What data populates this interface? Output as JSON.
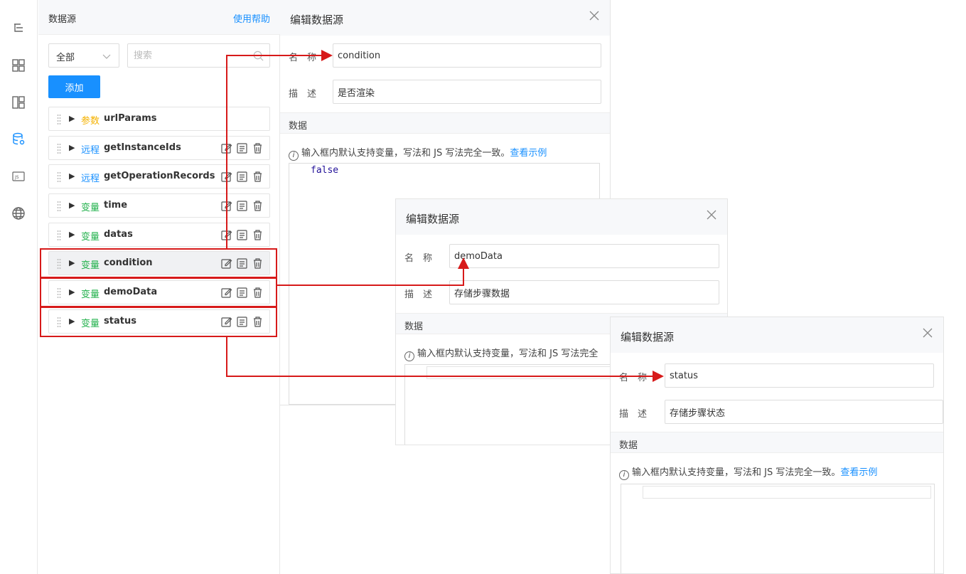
{
  "panel": {
    "title": "数据源",
    "help": "使用帮助",
    "filter_value": "全部",
    "search_placeholder": "搜索",
    "add_label": "添加"
  },
  "items": [
    {
      "tag": "参数",
      "tag_type": "param",
      "name": "urlParams"
    },
    {
      "tag": "远程",
      "tag_type": "remote",
      "name": "getInstanceIds"
    },
    {
      "tag": "远程",
      "tag_type": "remote",
      "name": "getOperationRecords"
    },
    {
      "tag": "变量",
      "tag_type": "var",
      "name": "time"
    },
    {
      "tag": "变量",
      "tag_type": "var",
      "name": "datas"
    },
    {
      "tag": "变量",
      "tag_type": "var",
      "name": "condition"
    },
    {
      "tag": "变量",
      "tag_type": "var",
      "name": "demoData"
    },
    {
      "tag": "变量",
      "tag_type": "var",
      "name": "status"
    }
  ],
  "dialog_common": {
    "title": "编辑数据源",
    "name_label": "名　称",
    "desc_label": "描　述",
    "data_section": "数据",
    "tip_text": "输入框内默认支持变量，写法和 JS 写法完全一致。",
    "tip_link": "查看示例",
    "tip_text_short": "输入框内默认支持变量，写法和 JS 写法完全"
  },
  "dialogs": {
    "condition": {
      "name": "condition",
      "desc": "是否渲染",
      "code": "false"
    },
    "demoData": {
      "name": "demoData",
      "desc": "存储步骤数据"
    },
    "status": {
      "name": "status",
      "desc": "存储步骤状态"
    }
  },
  "colors": {
    "accent": "#1890ff",
    "param": "#f5b200",
    "var": "#22b14c",
    "annotation": "#d71a1a"
  }
}
